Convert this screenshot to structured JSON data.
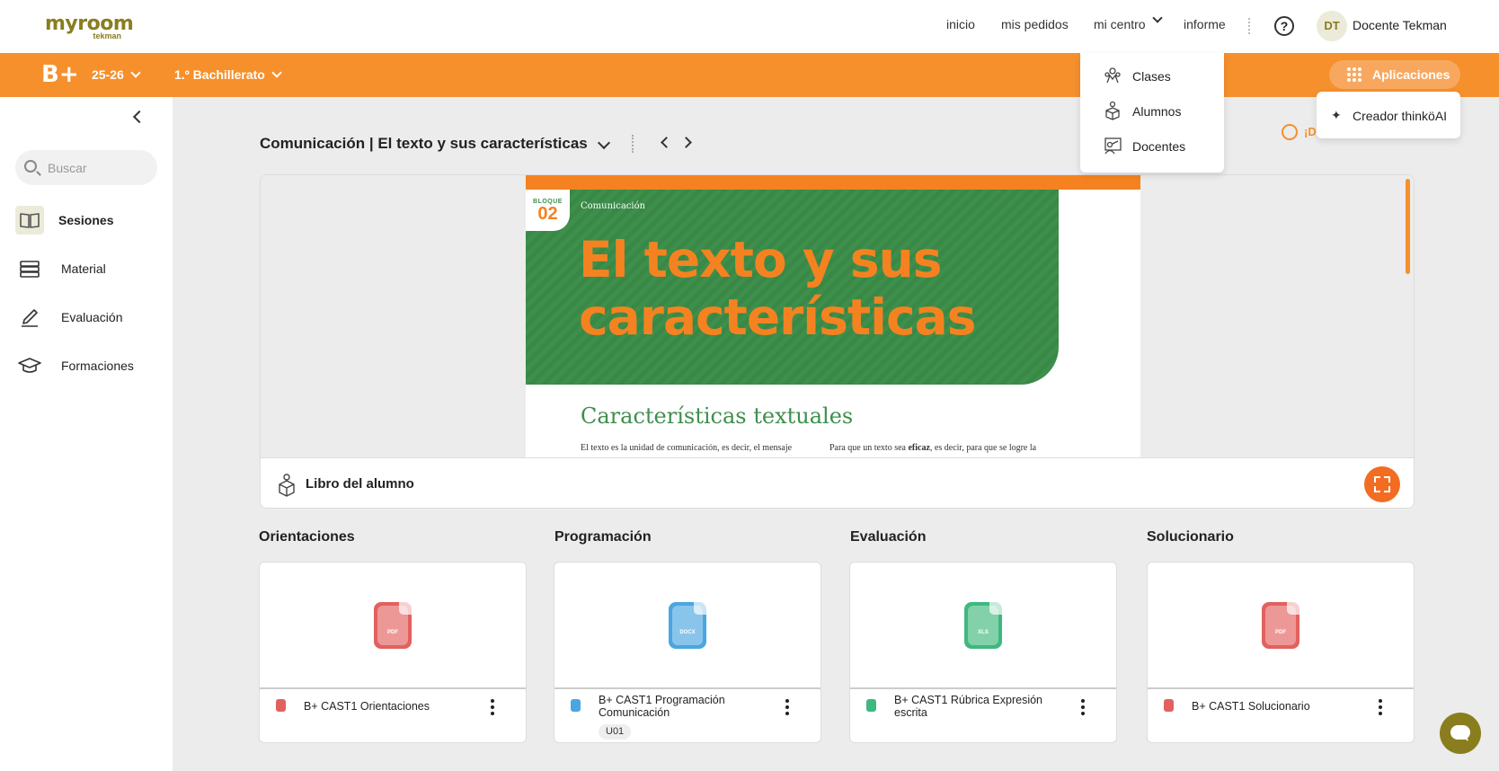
{
  "header": {
    "logo": "myroom",
    "logo_sub": "tekman",
    "nav": {
      "inicio": "inicio",
      "pedidos": "mis pedidos",
      "centro": "mi centro",
      "informe": "informe"
    },
    "help": "?",
    "avatar_initials": "DT",
    "user_name": "Docente Tekman"
  },
  "orange_bar": {
    "brand": "B+",
    "year": "25-26",
    "course": "1.º Bachillerato",
    "apps_label": "Aplicaciones",
    "color": "#f5902d"
  },
  "centro_menu": [
    "Clases",
    "Alumnos",
    "Docentes"
  ],
  "apps_menu": [
    "Creador thinköAI"
  ],
  "sidebar": {
    "search_placeholder": "Buscar",
    "items": [
      "Sesiones",
      "Material",
      "Evaluación",
      "Formaciones"
    ],
    "active": "Sesiones"
  },
  "main": {
    "title": "Comunicación | El texto y sus características",
    "feedback": "¡D",
    "viewer": {
      "block_label": "BLOQUE",
      "block_num": "02",
      "subject": "Comunicación",
      "title_line1": "El texto y sus",
      "title_line2": "características",
      "section": "Características textuales",
      "col1": "El texto es la unidad de comunicación, es decir, el mensaje",
      "col2_pre": "Para que un texto sea ",
      "col2_bold": "eficaz",
      "col2_post": ", es decir, para que se logre la",
      "footer_label": "Libro del alumno"
    }
  },
  "resources": [
    {
      "section": "Orientaciones",
      "file": "B+ CAST1 Orientaciones",
      "ext": "PDF",
      "color": "#e2615f",
      "tag": ""
    },
    {
      "section": "Programación",
      "file": "B+ CAST1 Programación Comunicación",
      "ext": "DOCX",
      "color": "#4aa6e0",
      "tag": "U01"
    },
    {
      "section": "Evaluación",
      "file": "B+ CAST1 Rúbrica Expresión escrita",
      "ext": "XLS",
      "color": "#3fb87f",
      "tag": ""
    },
    {
      "section": "Solucionario",
      "file": "B+ CAST1 Solucionario",
      "ext": "PDF",
      "color": "#e2615f",
      "tag": ""
    }
  ]
}
